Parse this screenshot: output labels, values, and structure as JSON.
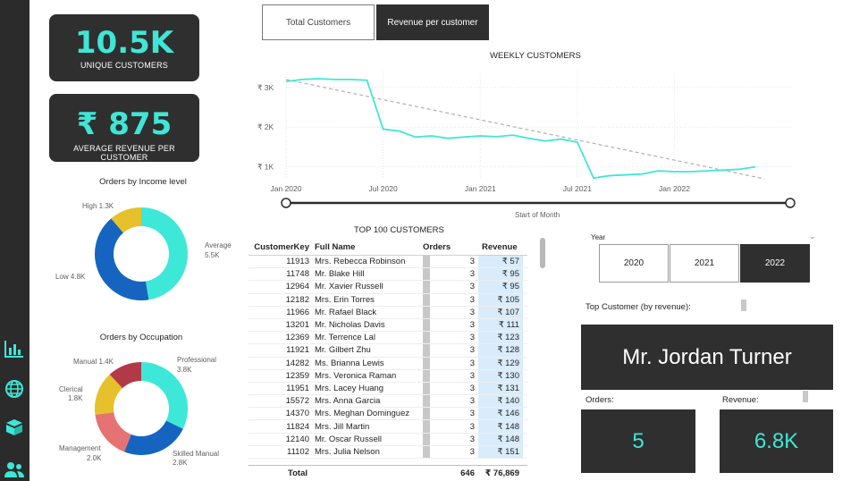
{
  "sidebar": {
    "icons": [
      "bar-chart-icon",
      "globe-icon",
      "box-icon",
      "users-icon"
    ]
  },
  "kpis": {
    "unique_customers": {
      "value": "10.5K",
      "label": "UNIQUE CUSTOMERS"
    },
    "avg_revenue": {
      "value": "₹ 875",
      "label": "AVERAGE REVENUE PER CUSTOMER"
    }
  },
  "tabs": {
    "total_customers": "Total Customers",
    "revenue_per_customer": "Revenue per customer"
  },
  "weekly_chart": {
    "title": "WEEKLY CUSTOMERS",
    "x_axis_title": "Start of Month",
    "y_ticks": [
      "₹ 3K",
      "₹ 2K",
      "₹ 1K"
    ],
    "x_ticks": [
      "Jan 2020",
      "Jul 2020",
      "Jan 2021",
      "Jul 2021",
      "Jan 2022"
    ]
  },
  "income_chart": {
    "title": "Orders by Income level",
    "labels": {
      "high": "High 1.3K",
      "average_name": "Average",
      "average_value": "5.5K",
      "low": "Low 4.8K"
    }
  },
  "occupation_chart": {
    "title": "Orders by Occupation",
    "labels": {
      "manual": "Manual 1.4K",
      "professional_name": "Professional",
      "professional_value": "3.8K",
      "clerical_name": "Clerical",
      "clerical_value": "1.8K",
      "management_name": "Management",
      "management_value": "2.0K",
      "skilled_name": "Skilled Manual",
      "skilled_value": "2.8K"
    }
  },
  "top_customers": {
    "title": "TOP 100 CUSTOMERS",
    "headers": {
      "key": "CustomerKey",
      "name": "Full Name",
      "orders": "Orders",
      "revenue": "Revenue"
    },
    "rows": [
      {
        "key": "11913",
        "name": "Mrs. Rebecca Robinson",
        "orders": "3",
        "revenue": "₹ 57"
      },
      {
        "key": "11748",
        "name": "Mr. Blake Hill",
        "orders": "3",
        "revenue": "₹ 95"
      },
      {
        "key": "12964",
        "name": "Mr. Xavier Russell",
        "orders": "3",
        "revenue": "₹ 95"
      },
      {
        "key": "12182",
        "name": "Mrs. Erin Torres",
        "orders": "3",
        "revenue": "₹ 105"
      },
      {
        "key": "11966",
        "name": "Mr. Rafael Black",
        "orders": "3",
        "revenue": "₹ 107"
      },
      {
        "key": "13201",
        "name": "Mr. Nicholas Davis",
        "orders": "3",
        "revenue": "₹ 111"
      },
      {
        "key": "12369",
        "name": "Mr. Terrence Lal",
        "orders": "3",
        "revenue": "₹ 123"
      },
      {
        "key": "11921",
        "name": "Mr. Gilbert Zhu",
        "orders": "3",
        "revenue": "₹ 128"
      },
      {
        "key": "14282",
        "name": "Ms. Brianna Lewis",
        "orders": "3",
        "revenue": "₹ 129"
      },
      {
        "key": "12359",
        "name": "Mrs. Veronica Raman",
        "orders": "3",
        "revenue": "₹ 130"
      },
      {
        "key": "11951",
        "name": "Mrs. Lacey Huang",
        "orders": "3",
        "revenue": "₹ 131"
      },
      {
        "key": "15572",
        "name": "Mrs. Anna Garcia",
        "orders": "3",
        "revenue": "₹ 140"
      },
      {
        "key": "14370",
        "name": "Mrs. Meghan Dominguez",
        "orders": "3",
        "revenue": "₹ 146"
      },
      {
        "key": "11824",
        "name": "Mrs. Jill Martin",
        "orders": "3",
        "revenue": "₹ 148"
      },
      {
        "key": "12140",
        "name": "Mr. Oscar Russell",
        "orders": "3",
        "revenue": "₹ 148"
      },
      {
        "key": "11102",
        "name": "Mrs. Julia Nelson",
        "orders": "3",
        "revenue": "₹ 151"
      }
    ],
    "total": {
      "label": "Total",
      "orders": "646",
      "revenue": "₹ 76,869"
    }
  },
  "year_slicer": {
    "label": "Year",
    "options": [
      "2020",
      "2021",
      "2022"
    ],
    "selected": "2022"
  },
  "top_customer": {
    "label": "Top Customer (by revenue):",
    "name": "Mr. Jordan Turner",
    "orders_label": "Orders:",
    "orders_value": "5",
    "revenue_label": "Revenue:",
    "revenue_value": "6.8K"
  },
  "colors": {
    "accent": "#3fe6d6",
    "dark_card": "#2f2f2f",
    "income_average": "#3de8d8",
    "income_low": "#1565c0",
    "income_high": "#e6c12b",
    "occ_professional": "#3de8d8",
    "occ_skilled": "#1565c0",
    "occ_management": "#e57373",
    "occ_clerical": "#e6c12b",
    "occ_manual": "#b23a48"
  },
  "chart_data": [
    {
      "type": "pie",
      "title": "Orders by Income level",
      "categories": [
        "Average",
        "Low",
        "High"
      ],
      "values": [
        5.5,
        4.8,
        1.3
      ]
    },
    {
      "type": "pie",
      "title": "Orders by Occupation",
      "categories": [
        "Professional",
        "Skilled Manual",
        "Management",
        "Clerical",
        "Manual"
      ],
      "values": [
        3.8,
        2.8,
        2.0,
        1.8,
        1.4
      ]
    },
    {
      "type": "line",
      "title": "WEEKLY CUSTOMERS",
      "xlabel": "Start of Month",
      "ylabel": "",
      "ylim": [
        0.7,
        3.4
      ],
      "x": [
        "Jan 2020",
        "Feb 2020",
        "Mar 2020",
        "Apr 2020",
        "May 2020",
        "Jun 2020",
        "Jul 2020",
        "Aug 2020",
        "Sep 2020",
        "Oct 2020",
        "Nov 2020",
        "Dec 2020",
        "Jan 2021",
        "Feb 2021",
        "Mar 2021",
        "Apr 2021",
        "May 2021",
        "Jun 2021",
        "Jul 2021",
        "Aug 2021",
        "Sep 2021",
        "Oct 2021",
        "Nov 2021",
        "Dec 2021",
        "Jan 2022",
        "Feb 2022",
        "Mar 2022",
        "Apr 2022",
        "May 2022",
        "Jun 2022"
      ],
      "series": [
        {
          "values": [
            3.15,
            3.2,
            3.22,
            3.2,
            3.2,
            3.18,
            1.95,
            1.9,
            1.75,
            1.78,
            1.72,
            1.75,
            1.78,
            1.76,
            1.8,
            1.72,
            1.65,
            1.7,
            1.62,
            0.72,
            0.78,
            0.8,
            0.82,
            0.9,
            0.88,
            0.88,
            0.9,
            0.92,
            0.94,
            1.0
          ]
        }
      ],
      "trend": {
        "start": 3.2,
        "end": 0.7
      }
    }
  ]
}
